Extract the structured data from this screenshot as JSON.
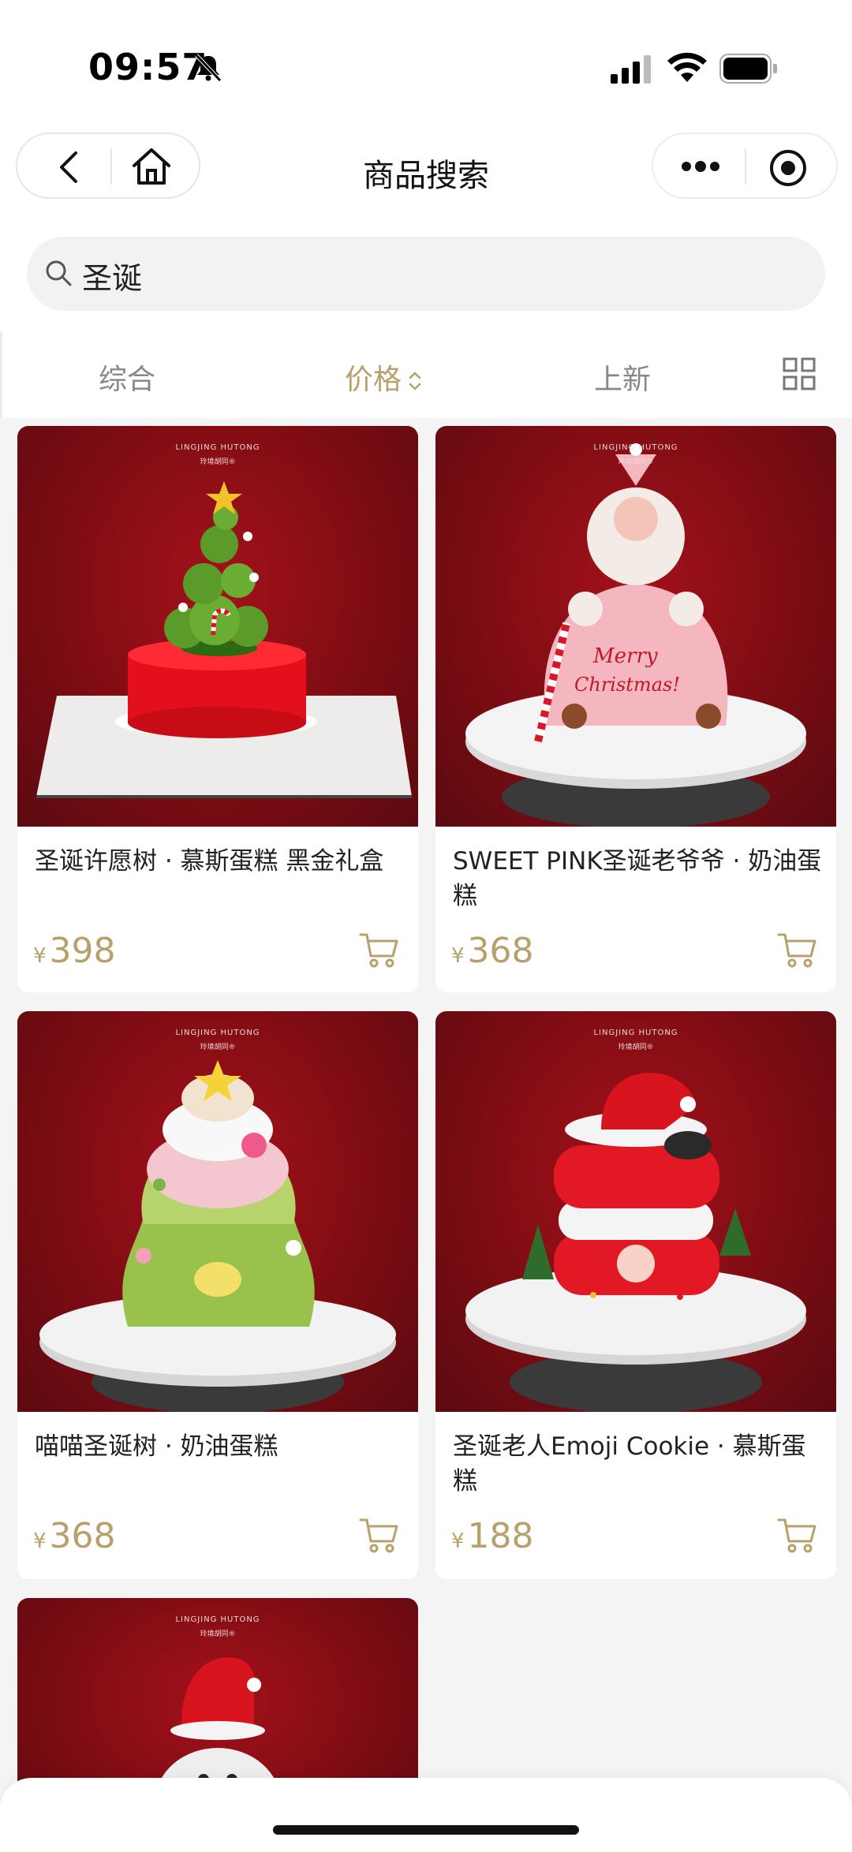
{
  "status_bar": {
    "time": "09:57"
  },
  "nav": {
    "title": "商品搜索"
  },
  "search": {
    "query": "圣诞"
  },
  "filters": [
    {
      "label": "综合",
      "active": false
    },
    {
      "label": "价格",
      "active": true
    },
    {
      "label": "上新",
      "active": false
    }
  ],
  "brand": {
    "name": "LINGJING HUTONG",
    "sub": "玲境胡同®"
  },
  "products": [
    {
      "name": "圣诞许愿树 · 慕斯蛋糕 黑金礼盒",
      "currency": "¥",
      "price": "398"
    },
    {
      "name": "SWEET PINK圣诞老爷爷 · 奶油蛋糕",
      "currency": "¥",
      "price": "368"
    },
    {
      "name": "喵喵圣诞树 · 奶油蛋糕",
      "currency": "¥",
      "price": "368"
    },
    {
      "name": "圣诞老人Emoji Cookie · 慕斯蛋糕",
      "currency": "¥",
      "price": "188"
    },
    {
      "name": "",
      "currency": "",
      "price": ""
    }
  ],
  "colors": {
    "accent": "#b9a06b",
    "card_bg": "#7a0c13",
    "page_bg": "#f4f4f4"
  },
  "cake_decor": {
    "merry": "Merry",
    "christmas": "Christmas!"
  }
}
